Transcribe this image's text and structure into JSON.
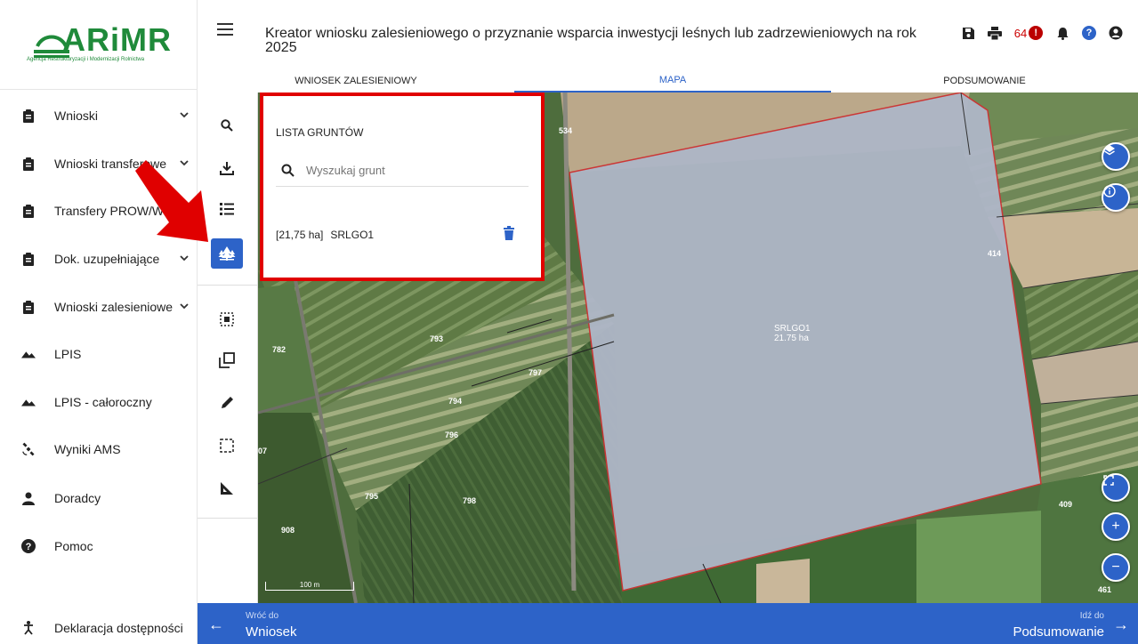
{
  "brand": {
    "name": "ARiMR",
    "tagline": "Agencja Restrukturyzacji i Modernizacji Rolnictwa",
    "color": "#1f8a3a"
  },
  "sidebar": {
    "items": [
      {
        "label": "Wnioski",
        "icon": "clipboard-icon",
        "has_chevron": true
      },
      {
        "label": "Wnioski transferowe",
        "icon": "clipboard-icon",
        "has_chevron": true
      },
      {
        "label": "Transfery PROW/WPR",
        "icon": "clipboard-icon",
        "has_chevron": false
      },
      {
        "label": "Dok. uzupełniające",
        "icon": "clipboard-icon",
        "has_chevron": true
      },
      {
        "label": "Wnioski zalesieniowe",
        "icon": "clipboard-icon",
        "has_chevron": true
      },
      {
        "label": "LPIS",
        "icon": "mountain-icon",
        "has_chevron": false
      },
      {
        "label": "LPIS - całoroczny",
        "icon": "mountain-icon",
        "has_chevron": false
      },
      {
        "label": "Wyniki AMS",
        "icon": "satellite-icon",
        "has_chevron": false
      },
      {
        "label": "Doradcy",
        "icon": "person-icon",
        "has_chevron": false
      },
      {
        "label": "Pomoc",
        "icon": "help-circle-icon",
        "has_chevron": false
      }
    ],
    "footer": {
      "label": "Deklaracja dostępności",
      "icon": "accessibility-icon"
    }
  },
  "header": {
    "title": "Kreator wniosku zalesieniowego o przyznanie wsparcia inwestycji leśnych lub zadrzewieniowych na rok 2025",
    "notification_count": "64",
    "tabs": [
      {
        "label": "WNIOSEK ZALESIENIOWY",
        "active": false
      },
      {
        "label": "MAPA",
        "active": true
      },
      {
        "label": "PODSUMOWANIE",
        "active": false
      }
    ]
  },
  "panel": {
    "title": "LISTA GRUNTÓW",
    "search_placeholder": "Wyszukaj grunt",
    "lands": [
      {
        "area": "[21,75 ha]",
        "name": "SRLGO1"
      }
    ]
  },
  "map": {
    "parcel_labels": [
      "534",
      "782",
      "793",
      "797",
      "794",
      "796",
      "795",
      "798",
      "908",
      "07",
      "461",
      "409",
      "414"
    ],
    "selected_parcel": {
      "name": "SRLGO1",
      "area": "21.75 ha"
    },
    "scale_label": "100 m"
  },
  "bottombar": {
    "back_small": "Wróć do",
    "back_big": "Wniosek",
    "forward_small": "Idź do",
    "forward_big": "Podsumowanie"
  },
  "colors": {
    "accent": "#2d63c8",
    "annotation": "#e00000"
  }
}
